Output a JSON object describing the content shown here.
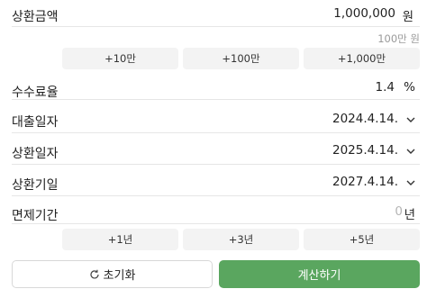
{
  "repayment_amount": {
    "label": "상환금액",
    "value": "1,000,000",
    "unit": "원",
    "hint": "100만 원"
  },
  "amount_chips": [
    "+10만",
    "+100만",
    "+1,000만"
  ],
  "fee_rate": {
    "label": "수수료율",
    "value": "1.4",
    "unit": "%"
  },
  "loan_date": {
    "label": "대출일자",
    "value": "2024.4.14."
  },
  "repay_date": {
    "label": "상환일자",
    "value": "2025.4.14."
  },
  "maturity_date": {
    "label": "상환기일",
    "value": "2027.4.14."
  },
  "exemption_period": {
    "label": "면제기간",
    "value": "0",
    "unit": "년"
  },
  "period_chips": [
    "+1년",
    "+3년",
    "+5년"
  ],
  "buttons": {
    "reset": "초기화",
    "calculate": "계산하기"
  },
  "colors": {
    "accent": "#5aa65f",
    "divider": "#e6e6e6",
    "chip_bg": "#f3f3f3"
  }
}
